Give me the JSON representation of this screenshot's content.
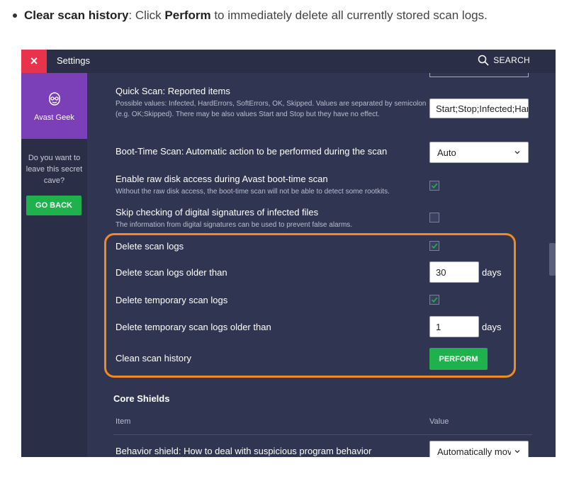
{
  "intro": {
    "title": "Clear scan history",
    "text_a": ": Click ",
    "action": "Perform",
    "text_b": " to immediately delete all currently stored scan logs."
  },
  "window": {
    "close_label": "×",
    "title": "Settings",
    "search_label": "SEARCH"
  },
  "sidebar": {
    "geek_label": "Avast Geek",
    "cave_text": "Do you want to leave this secret cave?",
    "go_back_label": "GO BACK"
  },
  "settings": {
    "quick_scan": {
      "label": "Quick Scan: Reported items",
      "description": "Possible values: Infected, HardErrors, SoftErrors, OK, Skipped. Values are separated by semicolon (e.g. OK;Skipped). There may be also values Start and Stop but they have no effect.",
      "value": "Start;Stop;Infected;HardErrors"
    },
    "boot_time": {
      "label": "Boot-Time Scan: Automatic action to be performed during the scan",
      "value": "Auto"
    },
    "raw_disk": {
      "label": "Enable raw disk access during Avast boot-time scan",
      "description": "Without the raw disk access, the boot-time scan will not be able to detect some rootkits.",
      "checked": true
    },
    "skip_signatures": {
      "label": "Skip checking of digital signatures of infected files",
      "description": "The information from digital signatures can be used to prevent false alarms.",
      "checked": false
    },
    "delete_logs": {
      "label": "Delete scan logs",
      "checked": true
    },
    "delete_logs_older": {
      "label": "Delete scan logs older than",
      "value": "30",
      "unit": "days"
    },
    "delete_temp_logs": {
      "label": "Delete temporary scan logs",
      "checked": true
    },
    "delete_temp_older": {
      "label": "Delete temporary scan logs older than",
      "value": "1",
      "unit": "days"
    },
    "clean_history": {
      "label": "Clean scan history",
      "button_label": "PERFORM"
    }
  },
  "core_shields": {
    "title": "Core Shields",
    "col_item": "Item",
    "col_value": "Value",
    "behavior": {
      "label": "Behavior shield: How to deal with suspicious program behavior",
      "value": "Automatically move to Chest"
    }
  },
  "colors": {
    "accent_green": "#1fb24c",
    "close_red": "#e8334a",
    "highlight_orange": "#f08a24",
    "geek_purple": "#7b3fb8"
  }
}
